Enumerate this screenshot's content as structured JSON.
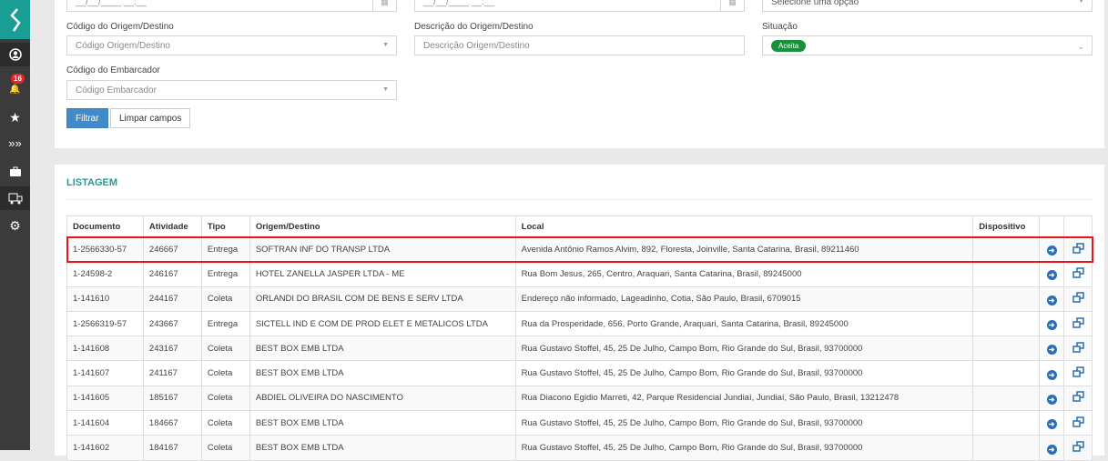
{
  "sidebar": {
    "notifications_count": "16",
    "items": [
      "profile",
      "notifications",
      "favorites",
      "chevrons",
      "briefcase",
      "truck",
      "settings"
    ]
  },
  "filters": {
    "date_placeholder": "__/__/____ __:__",
    "select_placeholder": "Selecione uma opção",
    "codigo_origem_label": "Código do Origem/Destino",
    "codigo_origem_placeholder": "Código Origem/Destino",
    "descricao_origem_label": "Descrição do Origem/Destino",
    "descricao_origem_placeholder": "Descrição Origem/Destino",
    "situacao_label": "Situação",
    "situacao_value": "Aceita",
    "embarcador_label": "Código do Embarcador",
    "embarcador_placeholder": "Código Embarcador",
    "filter_button": "Filtrar",
    "clear_button": "Limpar campos"
  },
  "listing": {
    "title": "LISTAGEM",
    "columns": [
      "Documento",
      "Atividade",
      "Tipo",
      "Origem/Destino",
      "Local",
      "Dispositivo"
    ],
    "rows": [
      [
        "1-2566330-57",
        "246667",
        "Entrega",
        "SOFTRAN INF DO TRANSP LTDA",
        "Avenida Antônio Ramos Alvim, 892, Floresta, Joinville, Santa Catarina, Brasil, 89211460",
        ""
      ],
      [
        "1-24598-2",
        "246167",
        "Entrega",
        "HOTEL ZANELLA JASPER LTDA - ME",
        "Rua Bom Jesus, 265, Centro, Araquari, Santa Catarina, Brasil, 89245000",
        ""
      ],
      [
        "1-141610",
        "244167",
        "Coleta",
        "ORLANDI DO BRASIL COM DE BENS E SERV LTDA",
        "Endereço não informado, Lageadinho, Cotia, São Paulo, Brasil, 6709015",
        ""
      ],
      [
        "1-2566319-57",
        "243667",
        "Entrega",
        "SICTELL IND E COM DE PROD ELET E METALICOS LTDA",
        "Rua da Prosperidade, 656, Porto Grande, Araquari, Santa Catarina, Brasil, 89245000",
        ""
      ],
      [
        "1-141608",
        "243167",
        "Coleta",
        "BEST BOX EMB LTDA",
        "Rua Gustavo Stoffel, 45, 25 De Julho, Campo Bom, Rio Grande do Sul, Brasil, 93700000",
        ""
      ],
      [
        "1-141607",
        "241167",
        "Coleta",
        "BEST BOX EMB LTDA",
        "Rua Gustavo Stoffel, 45, 25 De Julho, Campo Bom, Rio Grande do Sul, Brasil, 93700000",
        ""
      ],
      [
        "1-141605",
        "185167",
        "Coleta",
        "ABDIEL OLIVEIRA DO NASCIMENTO",
        "Rua Diacono Egidio Marreti, 42, Parque Residencial Jundiaí, Jundiaí, São Paulo, Brasil, 13212478",
        ""
      ],
      [
        "1-141604",
        "184667",
        "Coleta",
        "BEST BOX EMB LTDA",
        "Rua Gustavo Stoffel, 45, 25 De Julho, Campo Bom, Rio Grande do Sul, Brasil, 93700000",
        ""
      ],
      [
        "1-141602",
        "184167",
        "Coleta",
        "BEST BOX EMB LTDA",
        "Rua Gustavo Stoffel, 45, 25 De Julho, Campo Bom, Rio Grande do Sul, Brasil, 93700000",
        ""
      ]
    ],
    "highlighted_row": 0
  },
  "colors": {
    "accent": "#1a9e94",
    "primary": "#428bca",
    "success": "#17923b",
    "highlight": "#e8141b"
  }
}
